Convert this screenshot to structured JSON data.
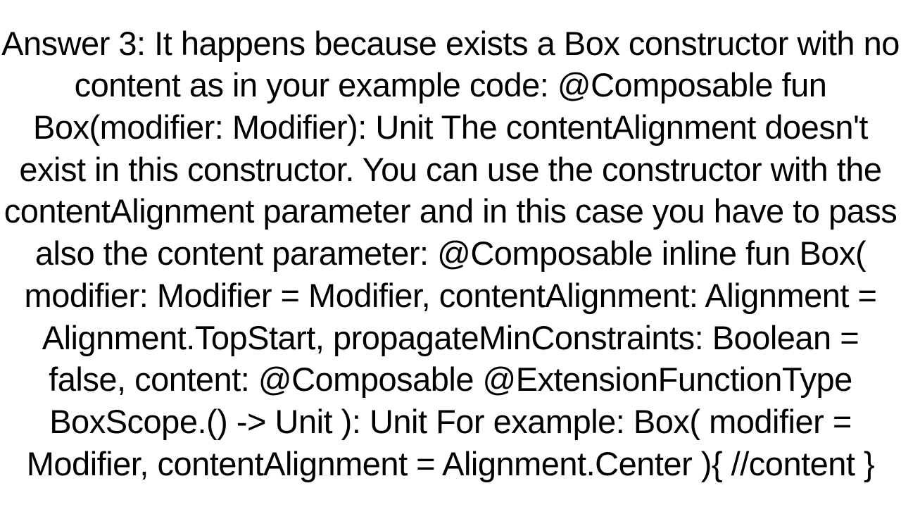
{
  "answer": {
    "text": "Answer 3: It happens because exists a Box constructor with no content as in your example code: @Composable fun Box(modifier: Modifier): Unit  The contentAlignment doesn't exist in this constructor. You can use the constructor with the contentAlignment parameter and in this case you have to pass also the content parameter: @Composable inline fun Box(     modifier: Modifier = Modifier,     contentAlignment: Alignment = Alignment.TopStart,     propagateMinConstraints: Boolean = false,     content: @Composable @ExtensionFunctionType BoxScope.() -> Unit ): Unit  For example: Box(     modifier = Modifier,     contentAlignment = Alignment.Center ){     //content }"
  }
}
